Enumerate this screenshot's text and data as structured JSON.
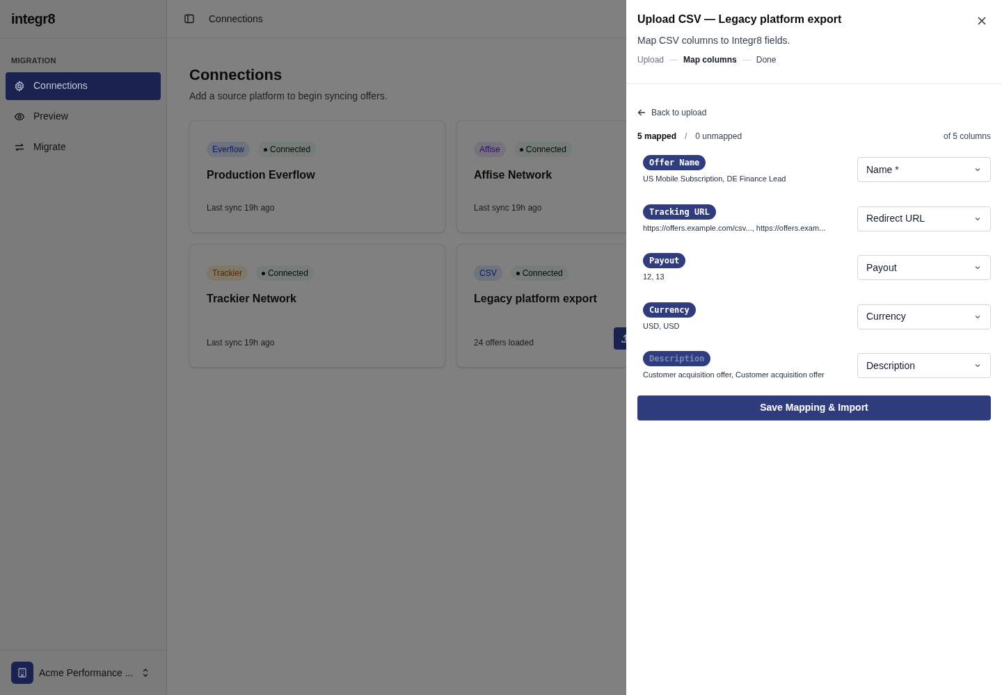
{
  "sidebar": {
    "logo": "integr8",
    "section": "MIGRATION",
    "items": [
      {
        "label": "Connections",
        "selected": true
      },
      {
        "label": "Preview",
        "selected": false
      },
      {
        "label": "Migrate",
        "selected": false
      }
    ],
    "account": {
      "name": "Acme Performance ..."
    }
  },
  "header": {
    "breadcrumb": "Connections"
  },
  "page": {
    "title": "Connections",
    "subtitle": "Add a source platform to begin syncing offers."
  },
  "cards": [
    {
      "platform": "Everflow",
      "color": "#6e737e",
      "status": "Connected",
      "name": "Production Everflow",
      "footer": "Last sync 19h ago",
      "upload": false
    },
    {
      "platform": "Affise",
      "color": "#76727e",
      "status": "Connected",
      "name": "Affise Network",
      "footer": "Last sync 19h ago",
      "upload": false
    },
    {
      "platform": "Trackier",
      "color": "#7e7868",
      "status": "Connected",
      "name": "Trackier Network",
      "footer": "Last sync 19h ago",
      "upload": false
    },
    {
      "platform": "CSV",
      "color": "#6e737e",
      "status": "Connected",
      "name": "Legacy platform export",
      "footer": "24 offers loaded",
      "upload": true
    }
  ],
  "panel": {
    "title": "Upload CSV — Legacy platform export",
    "subtitle": "Map CSV columns to Integr8 fields.",
    "steps": [
      {
        "label": "Upload",
        "completed": true,
        "selected": false
      },
      {
        "label": "Map columns",
        "completed": false,
        "selected": true
      },
      {
        "label": "Done",
        "completed": false,
        "selected": false
      }
    ],
    "back": "Back to upload",
    "mapped": "5 mapped",
    "separator": "/",
    "unmapped": "0 unmapped",
    "total": "of 5 columns",
    "columns": [
      {
        "name": "Offer Name",
        "samples": "US Mobile Subscription, DE Finance Lead",
        "field": "Name *",
        "dimmed": false
      },
      {
        "name": "Tracking URL",
        "samples": "https://offers.example.com/csv..., https://offers.exam...",
        "field": "Redirect URL",
        "dimmed": false
      },
      {
        "name": "Payout",
        "samples": "12, 13",
        "field": "Payout",
        "dimmed": false
      },
      {
        "name": "Currency",
        "samples": "USD, USD",
        "field": "Currency",
        "dimmed": false
      },
      {
        "name": "Description",
        "samples": "Customer acquisition offer, Customer acquisition offer",
        "field": "Description",
        "dimmed": true
      }
    ],
    "submit": "Save Mapping & Import"
  }
}
